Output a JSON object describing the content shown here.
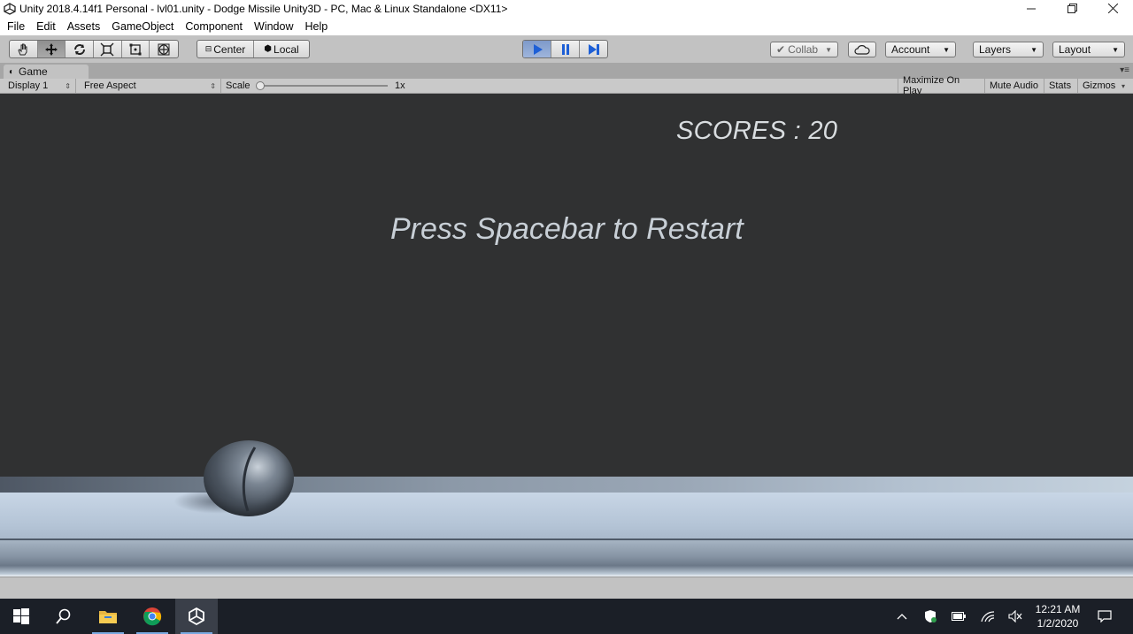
{
  "window": {
    "title": "Unity 2018.4.14f1 Personal - lvl01.unity - Dodge Missile Unity3D - PC, Mac & Linux Standalone <DX11>",
    "controls": [
      "minimize-icon",
      "restore-icon",
      "close-icon"
    ]
  },
  "menu": [
    "File",
    "Edit",
    "Assets",
    "GameObject",
    "Component",
    "Window",
    "Help"
  ],
  "toolbar": {
    "tools": [
      "hand-icon",
      "move-icon",
      "rotate-icon",
      "scale-icon",
      "rect-icon",
      "transform-icon"
    ],
    "pivot_center": "Center",
    "pivot_local": "Local",
    "play_controls": [
      "play-icon",
      "pause-icon",
      "step-icon"
    ],
    "collab": "Collab",
    "account": "Account",
    "layers": "Layers",
    "layout": "Layout"
  },
  "game_tab": {
    "label": "Game",
    "display": "Display 1",
    "aspect": "Free Aspect",
    "scale_label": "Scale",
    "scale_value": "1x",
    "maximize": "Maximize On Play",
    "mute": "Mute Audio",
    "stats": "Stats",
    "gizmos": "Gizmos"
  },
  "game": {
    "score_text": "SCORES : 20",
    "message": "Press Spacebar to Restart"
  },
  "taskbar": {
    "apps": [
      "windows-start-icon",
      "search-icon",
      "file-explorer-icon",
      "chrome-icon",
      "unity-icon"
    ],
    "time": "12:21 AM",
    "date": "1/2/2020"
  },
  "colors": {
    "viewport_bg": "#303132",
    "editor_bg": "#c2c2c2",
    "taskbar_bg": "#1b1f27"
  }
}
